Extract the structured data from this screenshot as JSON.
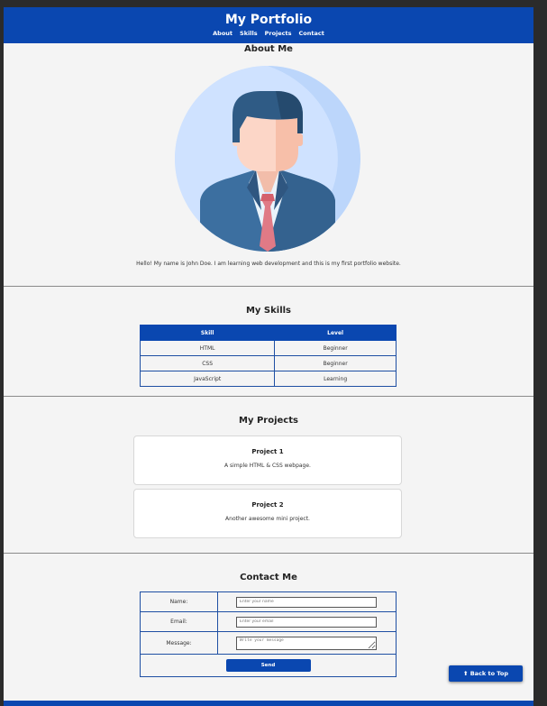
{
  "header": {
    "title": "My Portfolio",
    "nav": [
      "About",
      "Skills",
      "Projects",
      "Contact"
    ]
  },
  "about": {
    "heading": "About Me",
    "avatar": "businessman-avatar-icon",
    "text": "Hello! My name is John Doe. I am learning web development and this is my first portfolio website."
  },
  "skills": {
    "heading": "My Skills",
    "columns": [
      "Skill",
      "Level"
    ],
    "rows": [
      [
        "HTML",
        "Beginner"
      ],
      [
        "CSS",
        "Beginner"
      ],
      [
        "JavaScript",
        "Learning"
      ]
    ]
  },
  "projects": {
    "heading": "My Projects",
    "items": [
      {
        "title": "Project 1",
        "desc": "A simple HTML & CSS webpage."
      },
      {
        "title": "Project 2",
        "desc": "Another awesome mini project."
      }
    ]
  },
  "contact": {
    "heading": "Contact Me",
    "name_label": "Name:",
    "name_placeholder": "Enter your name",
    "email_label": "Email:",
    "email_placeholder": "Enter your email",
    "message_label": "Message:",
    "message_placeholder": "Write your message",
    "send_label": "Send"
  },
  "back_to_top": "⬆ Back to Top",
  "colors": {
    "primary": "#0a47b0",
    "background": "#f4f4f4",
    "avatar_bg": "#cfe2ff"
  }
}
